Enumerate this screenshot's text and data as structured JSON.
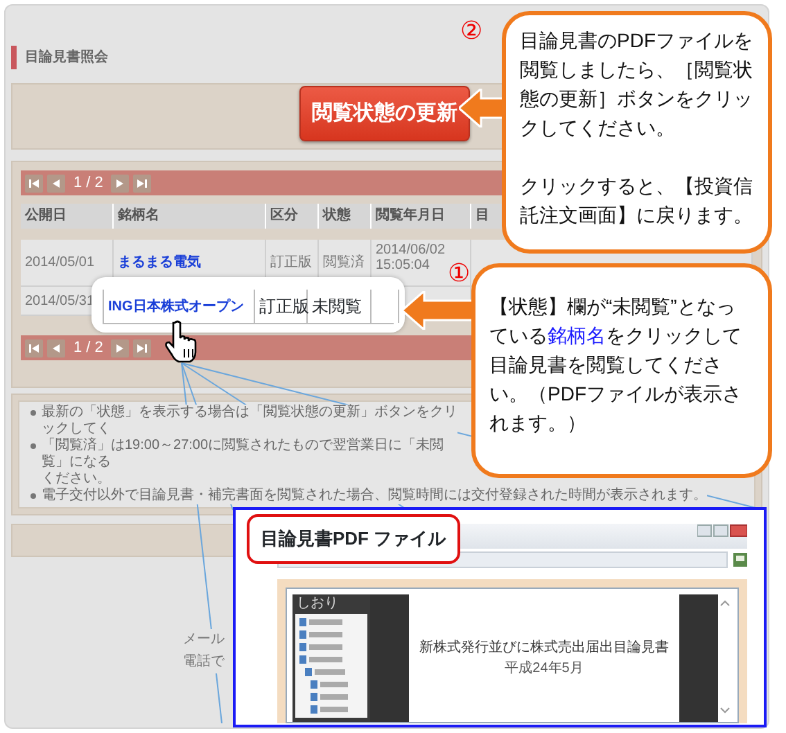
{
  "page": {
    "title": "目論見書照会",
    "update_button": "閲覧状態の更新",
    "pager_top": {
      "label": "1 / 2"
    },
    "table": {
      "columns": [
        "公開日",
        "銘柄名",
        "区分",
        "状態",
        "閲覧年月日",
        "目"
      ],
      "rows": [
        {
          "cells": [
            "2014/05/01",
            "まるまる電気",
            "訂正版",
            "閲覧済",
            "2014/06/02 15:05:04"
          ]
        },
        {
          "cells": [
            "2014/05/31"
          ]
        }
      ]
    },
    "pager_bottom": {
      "label": "1 / 2"
    },
    "notes": [
      {
        "text": "最新の「状態」を表示する場合は「閲覧状態の更新」ボタンをクリックしてく",
        "narrow": true
      },
      {
        "text": "「閲覧済」は19:00～27:00に閲覧されたもので翌営業日に「未閲覧」になる",
        "narrow": true,
        "continuation": "ください。"
      },
      {
        "text": "電子交付以外で目論見書・補完書面を閲覧された場合、閲覧時間には交付登録された時間が表示されます。",
        "narrow": false
      }
    ],
    "footer": [
      "メール",
      "電話で"
    ]
  },
  "popup_row": {
    "cells": [
      "ING日本株式オープン",
      "訂正版",
      "未閲覧"
    ]
  },
  "callouts": [
    {
      "marker": "②",
      "paragraphs": [
        "目論見書のPDFファイルを閲覧しましたら、［閲覧状態の更新］ボタンをクリックしてください。",
        "クリックすると、【投資信託注文画面】に戻ります。"
      ]
    },
    {
      "marker": "①",
      "before": "【状態】欄が“未閲覧”となっている",
      "highlight": "銘柄名",
      "after": "をクリックして目論見書を閲覧してください。（PDFファイルが表示されます。）"
    }
  ],
  "inset": {
    "label": "目論見書PDF ファイル",
    "sidebar_title": "しおり",
    "document_title": "新株式発行並びに株式売出届出目論見書",
    "document_date": "平成24年5月"
  }
}
